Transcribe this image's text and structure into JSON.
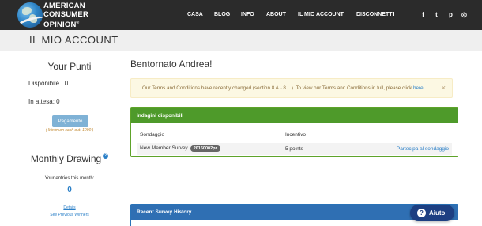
{
  "brand": {
    "line1": "AMERICAN",
    "line2": "CONSUMER",
    "line3": "OPINION",
    "mark": "®"
  },
  "nav": {
    "items": [
      {
        "label": "CASA"
      },
      {
        "label": "BLOG"
      },
      {
        "label": "INFO"
      },
      {
        "label": "ABOUT"
      },
      {
        "label": "IL MIO ACCOUNT"
      },
      {
        "label": "DISCONNETTI"
      }
    ],
    "social": [
      {
        "icon": "facebook-icon",
        "glyph": "f"
      },
      {
        "icon": "twitter-icon",
        "glyph": "t"
      },
      {
        "icon": "pinterest-icon",
        "glyph": "p"
      },
      {
        "icon": "instagram-icon",
        "glyph": "◎"
      }
    ]
  },
  "page": {
    "title": "IL MIO ACCOUNT"
  },
  "sidebar": {
    "points_title": "Your Punti",
    "available_label": "Disponibile : 0",
    "pending_label": "In attesa: 0",
    "payment_button": "Pagamento",
    "min_cashout": "( Minimum cash out: 1000 )",
    "drawing_title": "Monthly Drawing",
    "entries_label": "Your entries this month:",
    "entries_value": "0",
    "details_link": "Details",
    "winners_link": "See Previous Winners"
  },
  "main": {
    "welcome": "Bentornato Andrea!",
    "alert_text": "Our Terms and Conditions have recently changed (section 8 A.- 8 L.). To view our Terms and Conditions in full, please click ",
    "alert_link": "here",
    "alert_suffix": ".",
    "alert_close": "×",
    "surveys_panel": {
      "title": "indagini disponibili",
      "columns": [
        "Sondaggio",
        "Incentivo"
      ],
      "rows": [
        {
          "name": "New Member Survey",
          "code": "20160002pr",
          "incentive": "5 points",
          "action": "Partecipa al sondaggio"
        }
      ]
    },
    "history_panel": {
      "title": "Recent Survey History"
    }
  },
  "help_button": {
    "label": "Aiuto",
    "glyph": "?"
  },
  "colors": {
    "nav_bg": "#2b2b2b",
    "green_header": "#4e9a2a",
    "blue_header": "#2f6fb3",
    "link": "#2a7fc7",
    "alert_bg": "#fcf8e3",
    "help_bg": "#1d3f82"
  }
}
